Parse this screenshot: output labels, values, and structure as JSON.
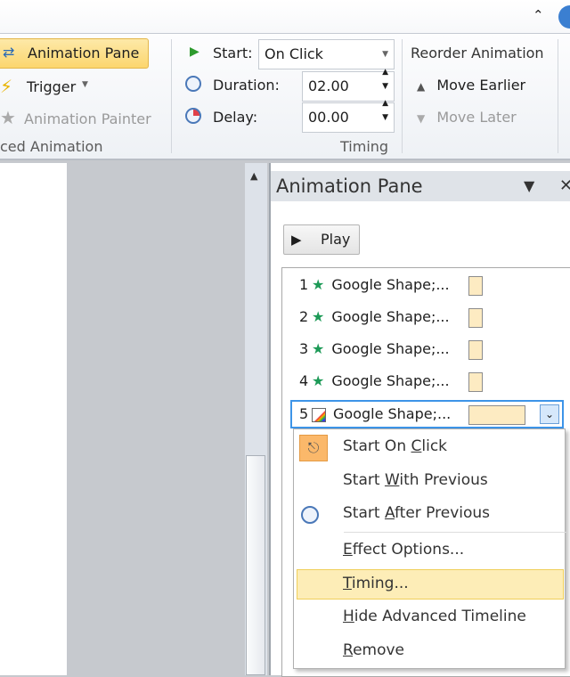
{
  "ribbon": {
    "advanced": {
      "animation_pane": "Animation Pane",
      "trigger": "Trigger",
      "animation_painter": "Animation Painter",
      "group_label": "ced Animation"
    },
    "timing": {
      "start_label": "Start:",
      "start_value": "On Click",
      "duration_label": "Duration:",
      "duration_value": "02.00",
      "delay_label": "Delay:",
      "delay_value": "00.00",
      "group_label": "Timing"
    },
    "reorder": {
      "title": "Reorder Animation",
      "move_earlier": "Move Earlier",
      "move_later": "Move Later"
    }
  },
  "pane": {
    "title": "Animation Pane",
    "play": "Play",
    "items": [
      {
        "num": "1",
        "name": "Google Shape;..."
      },
      {
        "num": "2",
        "name": "Google Shape;..."
      },
      {
        "num": "3",
        "name": "Google Shape;..."
      },
      {
        "num": "4",
        "name": "Google Shape;..."
      },
      {
        "num": "5",
        "name": "Google Shape;..."
      }
    ]
  },
  "menu": [
    {
      "pre": "Start On ",
      "key": "C",
      "post": "lick"
    },
    {
      "pre": "Start ",
      "key": "W",
      "post": "ith Previous"
    },
    {
      "pre": "Start ",
      "key": "A",
      "post": "fter Previous"
    },
    {
      "pre": "",
      "key": "E",
      "post": "ffect Options..."
    },
    {
      "pre": "",
      "key": "T",
      "post": "iming..."
    },
    {
      "pre": "",
      "key": "H",
      "post": "ide Advanced Timeline"
    },
    {
      "pre": "",
      "key": "R",
      "post": "emove"
    }
  ],
  "colors": {
    "accent": "#3d94e8",
    "highlight": "#fdedb7",
    "swatch": "#fdebc2"
  }
}
